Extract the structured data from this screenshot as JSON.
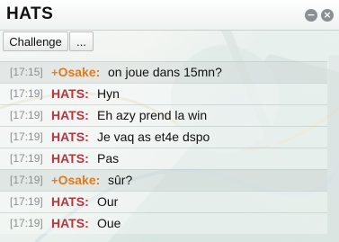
{
  "window": {
    "title": "HATS"
  },
  "toolbar": {
    "challenge_label": "Challenge",
    "more_label": "..."
  },
  "controls": {
    "minimize_glyph": "−",
    "close_glyph": "×"
  },
  "messages": [
    {
      "time": "[17:15]",
      "prefix": "+",
      "sender": "Osake:",
      "text": "on joue dans 15mn?"
    },
    {
      "time": "[17:19]",
      "prefix": "",
      "sender": "HATS:",
      "text": "Hyn"
    },
    {
      "time": "[17:19]",
      "prefix": "",
      "sender": "HATS:",
      "text": "Eh azy prend la win"
    },
    {
      "time": "[17:19]",
      "prefix": "",
      "sender": "HATS:",
      "text": "Je vaq as et4e dspo"
    },
    {
      "time": "[17:19]",
      "prefix": "",
      "sender": "HATS:",
      "text": "Pas"
    },
    {
      "time": "[17:19]",
      "prefix": "+",
      "sender": "Osake:",
      "text": "sûr?"
    },
    {
      "time": "[17:19]",
      "prefix": "",
      "sender": "HATS:",
      "text": "Our"
    },
    {
      "time": "[17:19]",
      "prefix": "",
      "sender": "HATS:",
      "text": "Oue"
    }
  ],
  "colors": {
    "osake": "#e07a1a",
    "hats": "#b5373f",
    "timestamp": "#8b8f90"
  }
}
